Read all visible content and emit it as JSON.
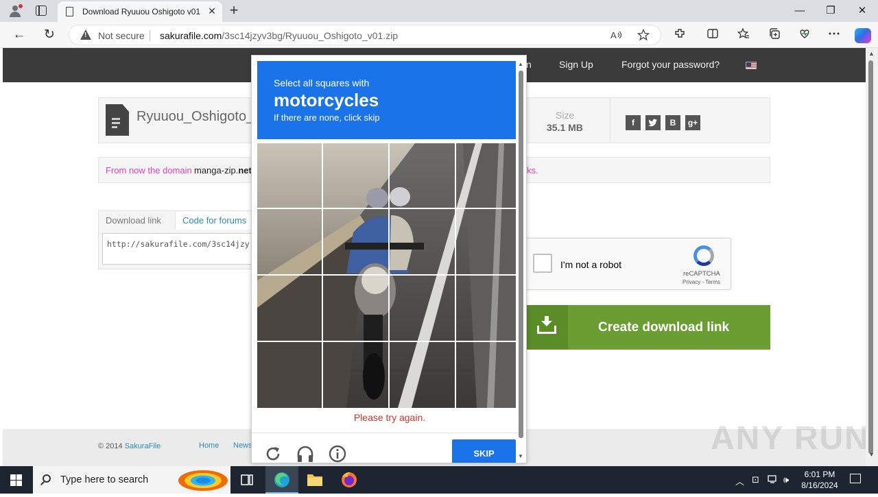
{
  "browser": {
    "tab_title": "Download Ryuuou Oshigoto v01",
    "tab_close": "✕",
    "new_tab": "+",
    "window_controls": {
      "minimize": "—",
      "maximize": "❐",
      "close": "✕"
    },
    "nav": {
      "back": "←",
      "refresh": "↻"
    },
    "security_text": "Not secure",
    "url_host": "sakurafile.com",
    "url_path": "/3sc14jzyv3bg/Ryuuou_Oshigoto_v01.zip",
    "omnibox_icons": [
      "read-aloud-icon",
      "favorite-star-icon"
    ],
    "toolbar_icons": [
      "extensions-icon",
      "split-screen-icon",
      "favorites-icon",
      "collections-icon",
      "browser-essentials-icon",
      "more-icon",
      "copilot-icon"
    ]
  },
  "site": {
    "header_links": {
      "partial": "n",
      "signup": "Sign Up",
      "forgot": "Forgot your password?"
    },
    "file_name": "Ryuuou_Oshigoto_v",
    "size_label": "Size",
    "size_value": "35.1 MB",
    "social": [
      "f",
      "t",
      "B",
      "g+"
    ],
    "notice_prefix": "From now the domain ",
    "notice_domain": "manga-zip.",
    "notice_domain_bold": "net",
    "notice_suffix": "ks.",
    "tabs": {
      "download_link": "Download link",
      "code_for_forums": "Code for forums"
    },
    "code_value": "http://sakurafile.com/3sc14jzy",
    "recaptcha": {
      "label": "I'm not a robot",
      "brand": "reCAPTCHA",
      "privacy": "Privacy",
      "terms": "Terms",
      "sep": " - "
    },
    "create_button": "Create download link",
    "footer": {
      "copyright": "© 2014 ",
      "brand": "SakuraFile",
      "home": "Home",
      "news": "News"
    },
    "watermark": "ANY RUN"
  },
  "captcha": {
    "instruction": "Select all squares with",
    "target": "motorcycles",
    "hint": "If there are none, click skip",
    "status": "Please try again.",
    "skip_label": "SKIP",
    "tools": [
      "reload-icon",
      "audio-challenge-icon",
      "info-icon"
    ],
    "grid": {
      "rows": 4,
      "cols": 4
    }
  },
  "taskbar": {
    "search_placeholder": "Type here to search",
    "apps": [
      "task-view-icon",
      "edge-icon",
      "file-explorer-icon",
      "firefox-icon"
    ],
    "time": "6:01 PM",
    "date": "8/16/2024"
  }
}
